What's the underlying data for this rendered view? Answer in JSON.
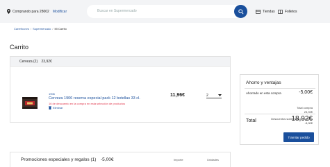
{
  "header": {
    "postal_label": "Comprando para 28002",
    "modify_link": "Modificar",
    "search_placeholder": "Buscar en Supermercado",
    "stores_label": "Tiendas",
    "leaflets_label": "Folletos"
  },
  "breadcrumb": {
    "items": [
      "Carrefour.es",
      "Supermercado",
      "Mi Carrito"
    ]
  },
  "page_title": "Carrito",
  "cart": {
    "group_name": "Cerveza (2)",
    "group_total": "23,92€",
    "item": {
      "brand": "1906",
      "name": "Cerveza 1906 reserva especial pack 12 botellas 33 cl.",
      "promo": "16 de descuento en la compra en esta selección de productos",
      "remove_label": "Eliminar",
      "price": "11,96€",
      "quantity": "2"
    }
  },
  "summary": {
    "title": "Ahorro y ventajas",
    "saved_label": "Ahorrado en esta compra",
    "saved_value": "-5,00€",
    "total_purchase_label": "Total compra",
    "total_purchase_value": "23,92€",
    "discount_label": "Descuentos sobre toda la compra",
    "discount_value": "-5,00€",
    "total_label": "Total",
    "total_value": "18,92€",
    "checkout_label": "Tramitar pedido"
  },
  "promotions": {
    "title": "Promociones especiales y regalos (1)",
    "value": "-5,00€",
    "col_amount": "Importe",
    "col_units": "Unidades"
  },
  "colors": {
    "brand": "#1a4f9c",
    "promo": "#e0354a",
    "topbar": "#f3f4f6"
  }
}
